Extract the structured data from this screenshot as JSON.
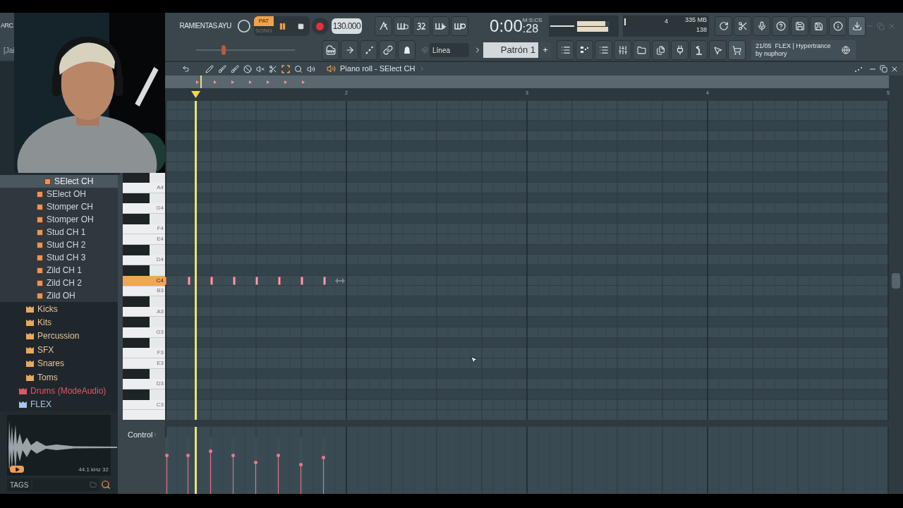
{
  "toolbar": {
    "menu_fragment": "ARC",
    "hint_fragment": "RAMIENTAS AYU",
    "field_fragment": "[Jai",
    "mode": [
      {
        "label": "PAT",
        "selected": true
      },
      {
        "label": "SONG",
        "selected": false
      }
    ],
    "pitch": {
      "level": 0.27
    },
    "meters": [
      {
        "level": 0.87
      },
      {
        "level": 0.96
      }
    ],
    "playing": true,
    "tempo": "130.000",
    "time_main": "0:00",
    "time_fraction": ":28",
    "time_units": "M:S:CS",
    "cpu_value": "4",
    "memory": "335 MB",
    "polyphony": "138",
    "snap": "Línea",
    "pattern": "Patrón 1",
    "add_label": "+",
    "news_line1": "21/05  FLEX | Hypertrance",
    "news_line2": "by nuphory"
  },
  "browser": {
    "items": [
      {
        "label": "SElect CH",
        "kind": "sample",
        "selected": true
      },
      {
        "label": "SElect OH",
        "kind": "sample",
        "selected": false
      },
      {
        "label": "Stomper CH",
        "kind": "sample",
        "selected": false
      },
      {
        "label": "Stomper OH",
        "kind": "sample",
        "selected": false
      },
      {
        "label": "Stud CH 1",
        "kind": "sample",
        "selected": false
      },
      {
        "label": "Stud CH 2",
        "kind": "sample",
        "selected": false
      },
      {
        "label": "Stud CH 3",
        "kind": "sample",
        "selected": false
      },
      {
        "label": "Zild CH 1",
        "kind": "sample",
        "selected": false
      },
      {
        "label": "Zild CH 2",
        "kind": "sample",
        "selected": false
      },
      {
        "label": "Zild OH",
        "kind": "sample",
        "selected": false
      },
      {
        "label": "Kicks",
        "kind": "folder",
        "selected": false
      },
      {
        "label": "Kits",
        "kind": "folder",
        "selected": false
      },
      {
        "label": "Percussion",
        "kind": "folder",
        "selected": false
      },
      {
        "label": "SFX",
        "kind": "folder",
        "selected": false
      },
      {
        "label": "Snares",
        "kind": "folder",
        "selected": false
      },
      {
        "label": "Toms",
        "kind": "folder",
        "selected": false
      },
      {
        "label": "Drums (ModeAudio)",
        "kind": "pack",
        "color": "#e0566a",
        "selected": false
      },
      {
        "label": "FLEX",
        "kind": "pack",
        "color": "#a8c4e6",
        "selected": false
      }
    ],
    "sample_info": "44.1 kHz 32",
    "tags_label": "TAGS"
  },
  "piano_roll": {
    "title": "Piano roll - SElect CH",
    "bars": [
      "2",
      "3",
      "4",
      "5"
    ],
    "keys": [
      {
        "label": "A4",
        "selected": false
      },
      {
        "label": "G4",
        "selected": false
      },
      {
        "label": "F4",
        "selected": false
      },
      {
        "label": "E4",
        "selected": false
      },
      {
        "label": "D4",
        "selected": false
      },
      {
        "label": "C4",
        "selected": true
      },
      {
        "label": "B3",
        "selected": false
      },
      {
        "label": "A3",
        "selected": false
      },
      {
        "label": "G3",
        "selected": false
      },
      {
        "label": "F3",
        "selected": false
      },
      {
        "label": "E3",
        "selected": false
      },
      {
        "label": "D3",
        "selected": false
      },
      {
        "label": "C3",
        "selected": false
      }
    ],
    "control_label": "Control",
    "notes": [
      {
        "level": 0.7
      },
      {
        "level": 0.7
      },
      {
        "level": 0.78
      },
      {
        "level": 0.7
      },
      {
        "level": 0.58
      },
      {
        "level": 0.7
      },
      {
        "level": 0.54
      },
      {
        "level": 0.66
      }
    ]
  }
}
